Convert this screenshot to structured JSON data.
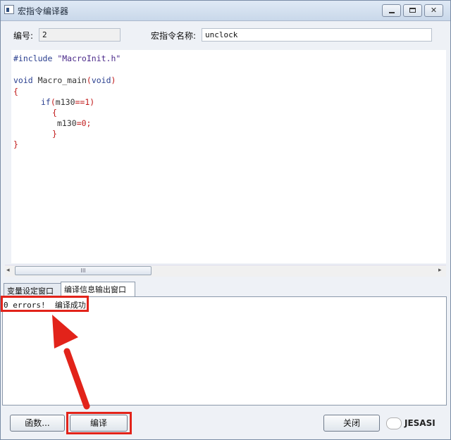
{
  "window": {
    "title": "宏指令编译器"
  },
  "header": {
    "number_label": "编号:",
    "number_value": "2",
    "name_label": "宏指令名称:",
    "name_value": "unclock"
  },
  "code": {
    "lines": [
      "#include \"MacroInit.h\"",
      "void Macro_main(void)",
      "{",
      "if(m130==1)",
      "{",
      "m130=0;",
      "}",
      "}"
    ],
    "scroll_thumb": "III"
  },
  "tabs": [
    "变量设定窗口",
    "编译信息输出窗口"
  ],
  "output": {
    "message": "0 errors!  编译成功!"
  },
  "buttons": {
    "functions": "函数...",
    "compile": "编译",
    "close": "关闭"
  },
  "watermark": {
    "text": "JESASI"
  },
  "colors": {
    "highlight": "#e2231a",
    "keyword": "#2a3f8f",
    "operator": "#c01818"
  }
}
